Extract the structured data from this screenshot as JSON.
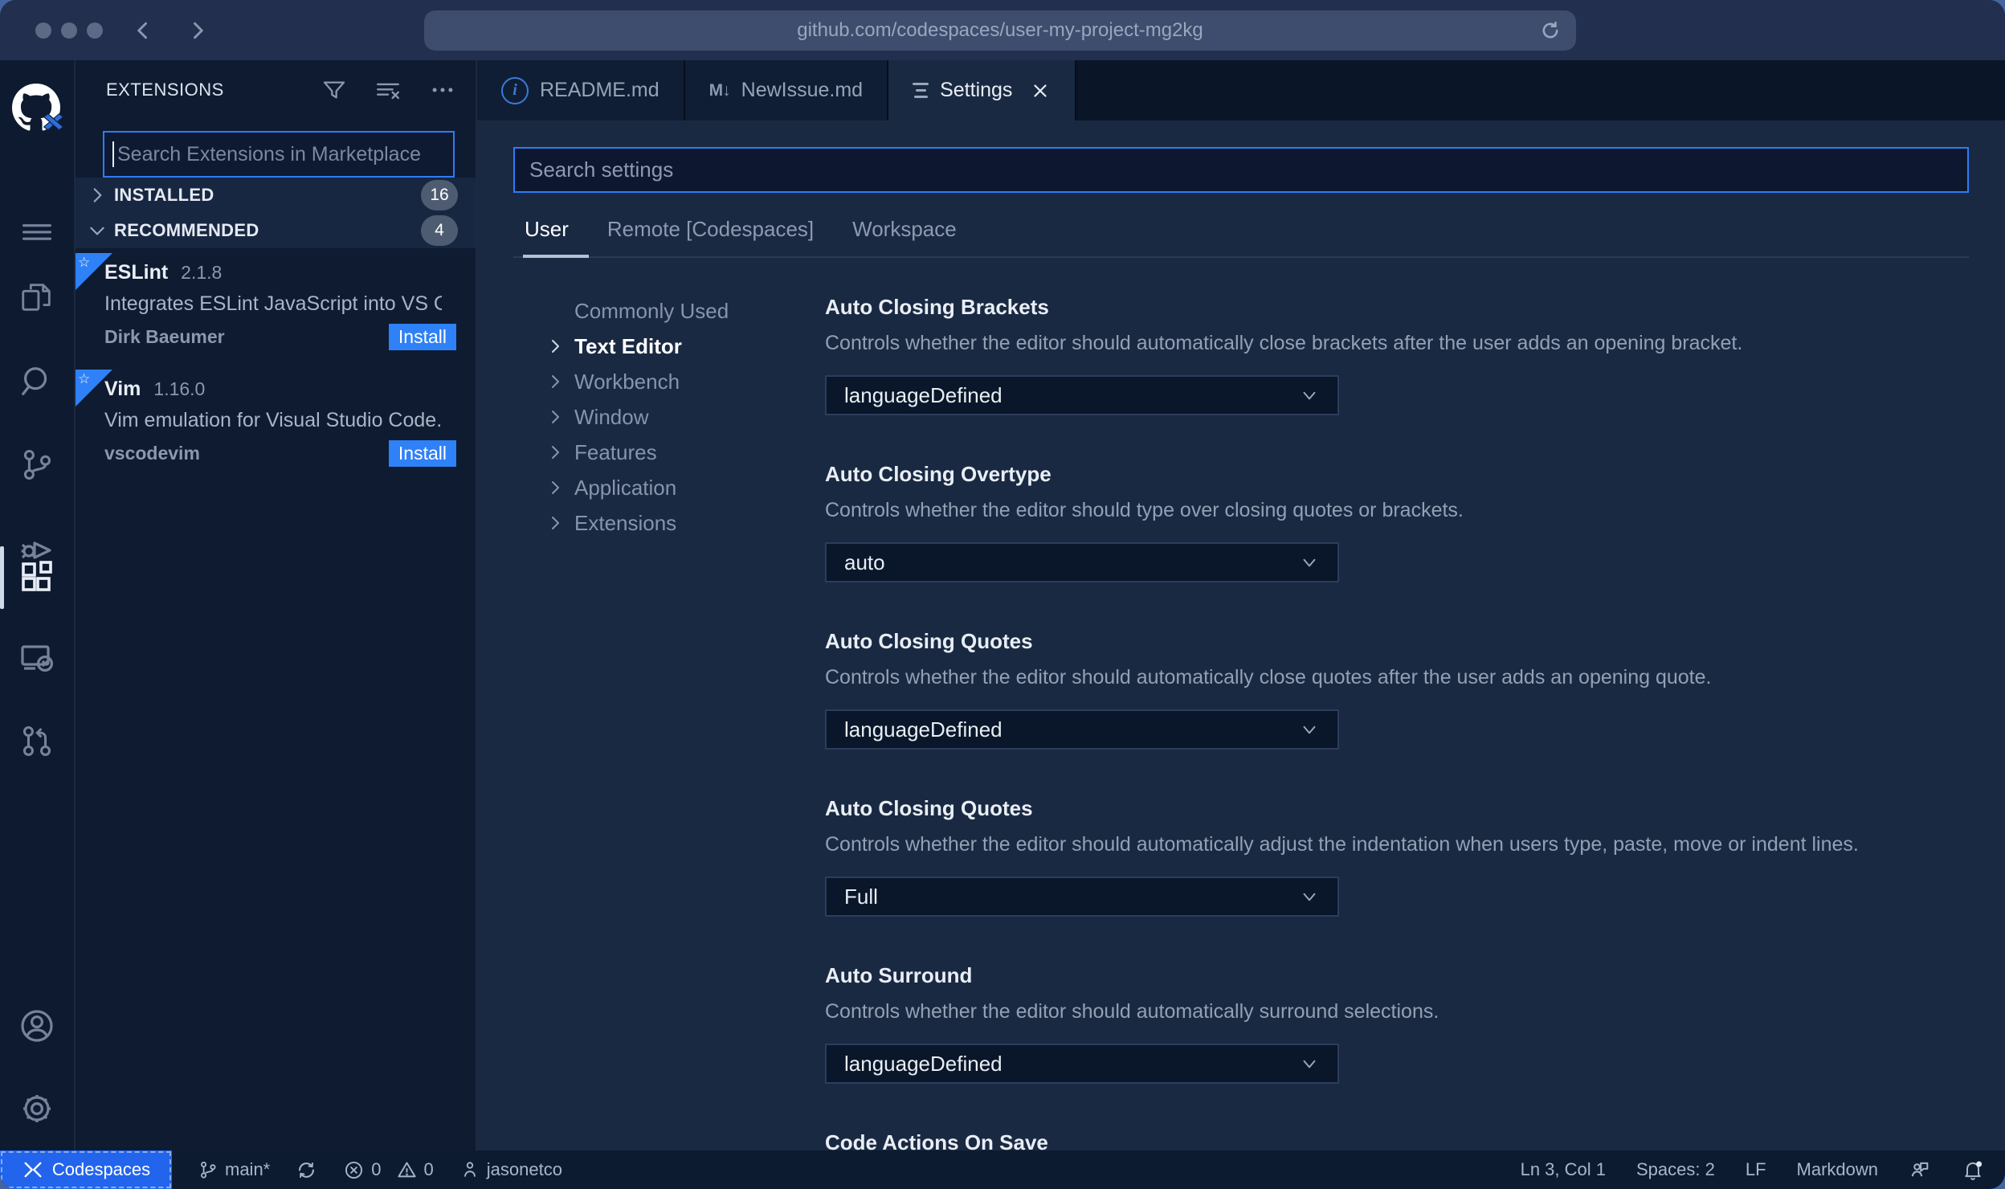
{
  "browser": {
    "url": "github.com/codespaces/user-my-project-mg2kg",
    "icons": {
      "back": "chevron-left",
      "forward": "chevron-right",
      "reload": "refresh-arrow"
    }
  },
  "activity_bar": {
    "icons": [
      "github-octocat-logo",
      "menu",
      "explorer-files",
      "search",
      "source-control",
      "run-debug",
      "extensions",
      "remote-explorer",
      "pull-request",
      "account",
      "settings-gear"
    ],
    "active_icon": "extensions"
  },
  "sidebar": {
    "title": "EXTENSIONS",
    "header_icons": [
      "filter-funnel",
      "clear-search",
      "more-actions"
    ],
    "search": {
      "placeholder": "Search Extensions in Marketplace",
      "value": ""
    },
    "sections": [
      {
        "label": "INSTALLED",
        "count": "16",
        "state": "collapsed"
      },
      {
        "label": "RECOMMENDED",
        "count": "4",
        "state": "expanded"
      }
    ],
    "extensions": [
      {
        "name": "ESLint",
        "version": "2.1.8",
        "description": "Integrates ESLint JavaScript into VS C...",
        "author": "Dirk Baeumer",
        "action": "Install"
      },
      {
        "name": "Vim",
        "version": "1.16.0",
        "description": "Vim emulation for Visual Studio Code...",
        "author": "vscodevim",
        "action": "Install"
      }
    ]
  },
  "tabs": [
    {
      "label": "README.md",
      "icon": "info-circle"
    },
    {
      "label": "NewIssue.md",
      "icon": "markdown-down"
    },
    {
      "label": "Settings",
      "icon": "settings-lines",
      "active": true,
      "close": "x"
    }
  ],
  "settings": {
    "search": {
      "placeholder": "Search settings",
      "value": ""
    },
    "scopes": [
      {
        "label": "User",
        "active": true
      },
      {
        "label": "Remote [Codespaces]",
        "active": false
      },
      {
        "label": "Workspace",
        "active": false
      }
    ],
    "toc": [
      {
        "label": "Commonly Used",
        "chevron": false,
        "active": false
      },
      {
        "label": "Text Editor",
        "chevron": true,
        "active": true
      },
      {
        "label": "Workbench",
        "chevron": true,
        "active": false
      },
      {
        "label": "Window",
        "chevron": true,
        "active": false
      },
      {
        "label": "Features",
        "chevron": true,
        "active": false
      },
      {
        "label": "Application",
        "chevron": true,
        "active": false
      },
      {
        "label": "Extensions",
        "chevron": true,
        "active": false
      }
    ],
    "items": [
      {
        "title": "Auto Closing Brackets",
        "description": "Controls whether the editor should automatically close brackets after the user adds an opening bracket.",
        "value": "languageDefined"
      },
      {
        "title": "Auto Closing Overtype",
        "description": "Controls whether the editor should type over closing quotes or brackets.",
        "value": "auto"
      },
      {
        "title": "Auto Closing Quotes",
        "description": "Controls whether the editor should automatically close quotes after the user adds an opening quote.",
        "value": "languageDefined"
      },
      {
        "title": "Auto Closing Quotes",
        "description": "Controls whether the editor should automatically adjust the indentation when users type, paste, move or indent lines.",
        "value": "Full"
      },
      {
        "title": "Auto Surround",
        "description": "Controls whether the editor should automatically surround selections.",
        "value": "languageDefined"
      },
      {
        "title": "Code Actions On Save",
        "description": "",
        "value": ""
      }
    ]
  },
  "status_bar": {
    "codespaces": "Codespaces",
    "branch": "main*",
    "errors": "0",
    "warnings": "0",
    "user": "jasonetco",
    "line_col": "Ln 3, Col 1",
    "spaces": "Spaces: 2",
    "eol": "LF",
    "language": "Markdown",
    "right_icons": [
      "feedback",
      "bell-dot"
    ]
  },
  "colors": {
    "accent_blue": "#2e7cf6",
    "install_blue": "#2f81f7",
    "codespaces_blue": "#2265ec",
    "chrome": "#222f4e",
    "sidebar_bg": "#0e1b31",
    "editor_bg": "#1a2942",
    "badge_gray": "#4e5c72"
  }
}
